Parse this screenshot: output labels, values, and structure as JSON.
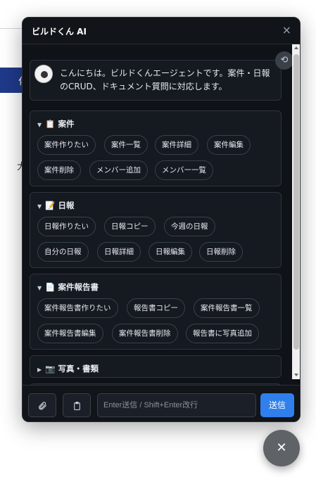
{
  "background": {
    "bar_text": "化",
    "side_text": "大"
  },
  "panel": {
    "title": "ビルドくん AI",
    "close": "×"
  },
  "greeting": {
    "message": "こんにちは。ビルドくんエージェントです。案件・日報のCRUD、ドキュメント質問に対応します。"
  },
  "sections": {
    "cases": {
      "emoji": "📋",
      "title": "案件",
      "chips": [
        "案件作りたい",
        "案件一覧",
        "案件詳細",
        "案件編集",
        "案件削除",
        "メンバー追加",
        "メンバー一覧"
      ]
    },
    "daily": {
      "emoji": "📝",
      "title": "日報",
      "chips": [
        "日報作りたい",
        "日報コピー",
        "今週の日報",
        "自分の日報",
        "日報詳細",
        "日報編集",
        "日報削除"
      ]
    },
    "reports": {
      "emoji": "📄",
      "title": "案件報告書",
      "chips": [
        "案件報告書作りたい",
        "報告書コピー",
        "案件報告書一覧",
        "案件報告書編集",
        "案件報告書削除",
        "報告書に写真追加"
      ]
    },
    "photos": {
      "emoji": "📷",
      "title": "写真・書類"
    }
  },
  "footer": {
    "input_placeholder": "Enter送信 / Shift+Enter改行",
    "send_label": "送信"
  },
  "icons": {
    "attach": "paperclip-icon",
    "clipboard": "clipboard-icon",
    "reset": "refresh-icon",
    "fab_close": "close-icon"
  },
  "colors": {
    "accent": "#2f80ed",
    "panel_bg": "#1b1f27"
  }
}
